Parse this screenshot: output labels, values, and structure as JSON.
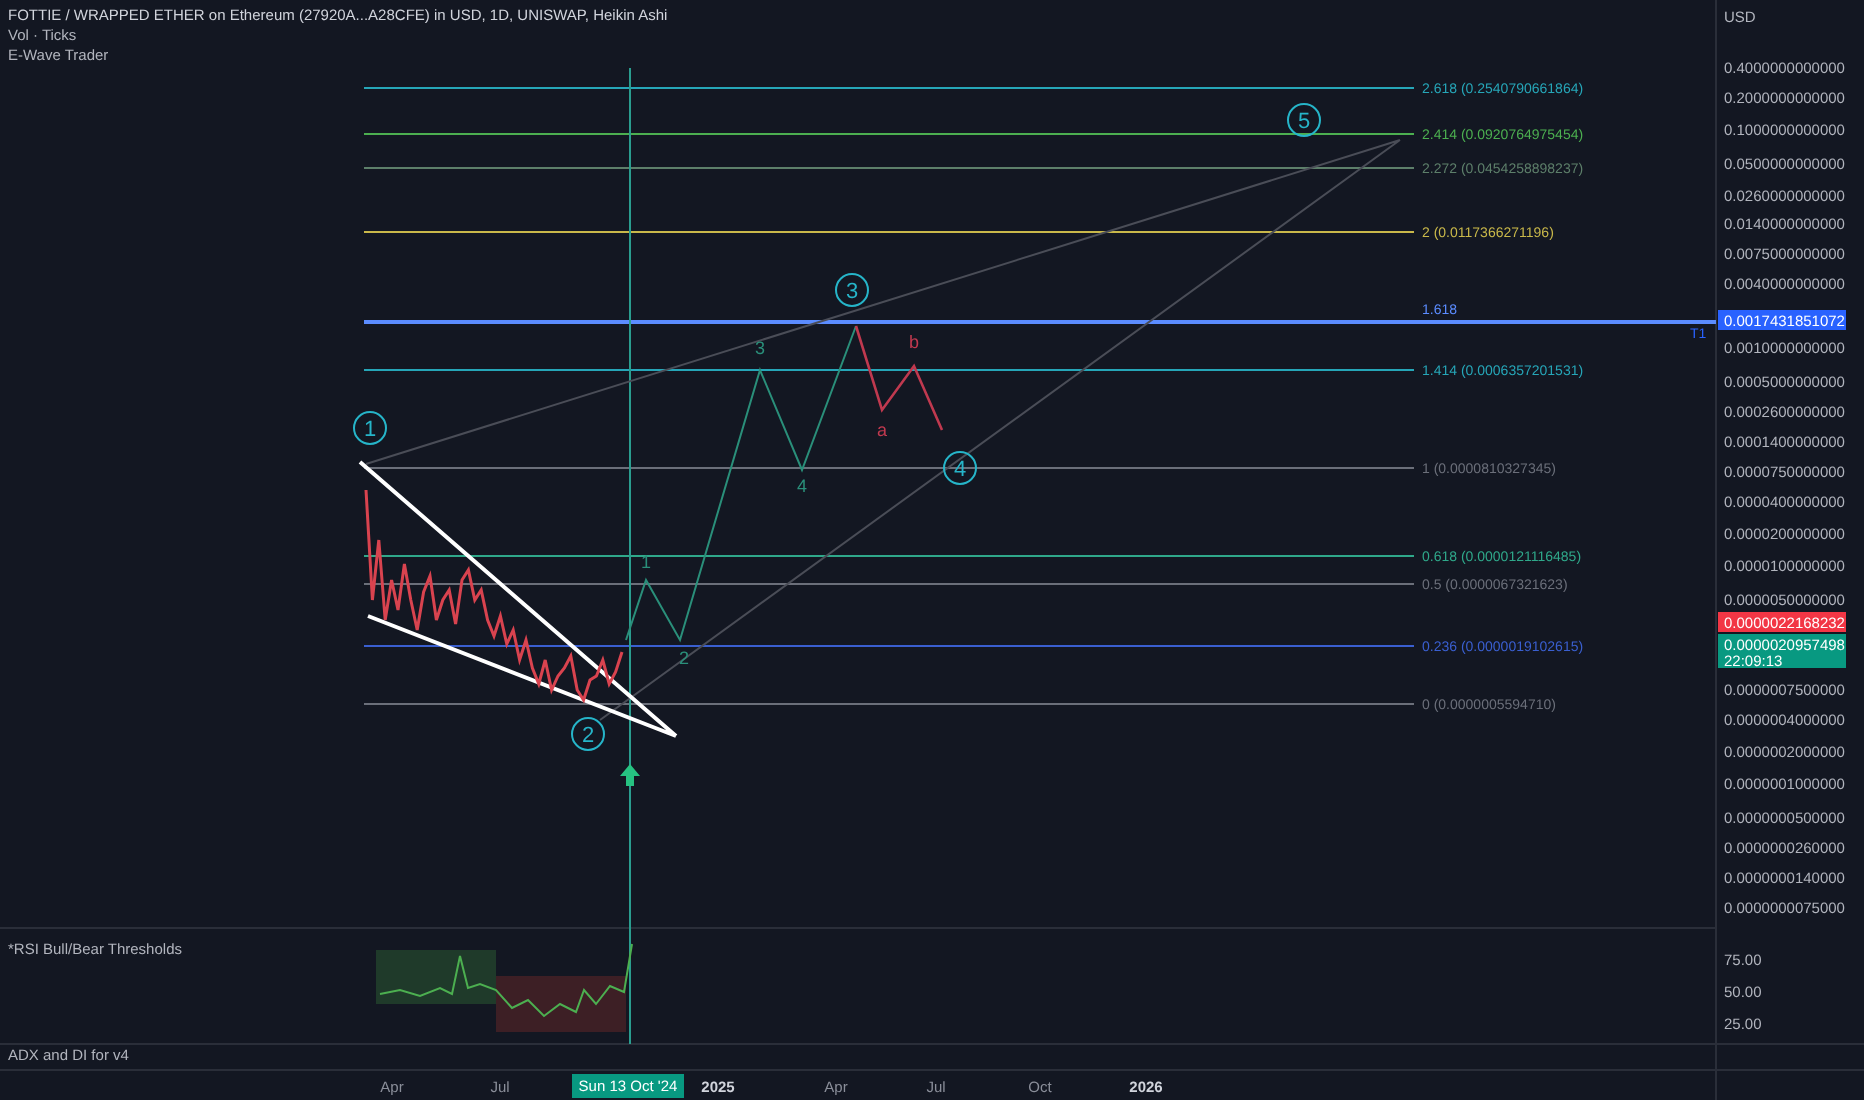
{
  "header": {
    "title": "FOTTIE / WRAPPED ETHER on Ethereum (27920A...A28CFE) in USD, 1D, UNISWAP, Heikin Ashi",
    "indicators": [
      "Vol · Ticks",
      "E-Wave Trader"
    ]
  },
  "fib_levels": [
    {
      "label": "2.618 (0.2540790661864)",
      "color": "#26a6b8"
    },
    {
      "label": "2.414 (0.0920764975454)",
      "color": "#4caf50"
    },
    {
      "label": "2.272 (0.0454258898237)",
      "color": "#5d7f6a"
    },
    {
      "label": "2 (0.0117366271196)",
      "color": "#c9b84a"
    },
    {
      "label": "1.618",
      "color": "#5b8cff"
    },
    {
      "label": "1.414 (0.0006357201531)",
      "color": "#26a6b8"
    },
    {
      "label": "1 (0.0000810327345)",
      "color": "#6b6f7a"
    },
    {
      "label": "0.618 (0.0000121116485)",
      "color": "#2fa88a"
    },
    {
      "label": "0.5 (0.0000067321623)",
      "color": "#6b6f7a"
    },
    {
      "label": "0.236 (0.0000019102615)",
      "color": "#3a5fd0"
    },
    {
      "label": "0 (0.0000005594710)",
      "color": "#6b6f7a"
    }
  ],
  "wave_labels": [
    {
      "text": "1",
      "kind": "major",
      "color": "#26b5c9"
    },
    {
      "text": "2",
      "kind": "major",
      "color": "#26b5c9"
    },
    {
      "text": "3",
      "kind": "major",
      "color": "#26b5c9"
    },
    {
      "text": "4",
      "kind": "major",
      "color": "#26b5c9"
    },
    {
      "text": "5",
      "kind": "major",
      "color": "#26b5c9"
    },
    {
      "text": "1",
      "kind": "minor",
      "color": "#2a8f7a"
    },
    {
      "text": "2",
      "kind": "minor",
      "color": "#2a8f7a"
    },
    {
      "text": "3",
      "kind": "minor",
      "color": "#2a8f7a"
    },
    {
      "text": "4",
      "kind": "minor",
      "color": "#2a8f7a"
    },
    {
      "text": "a",
      "kind": "minor",
      "color": "#c0394f"
    },
    {
      "text": "b",
      "kind": "minor",
      "color": "#c0394f"
    }
  ],
  "target_label": "T1",
  "price_axis": {
    "currency": "USD",
    "ticks": [
      "0.4000000000000",
      "0.2000000000000",
      "0.1000000000000",
      "0.0500000000000",
      "0.0260000000000",
      "0.0140000000000",
      "0.0075000000000",
      "0.0040000000000",
      "0.0010000000000",
      "0.0005000000000",
      "0.0002600000000",
      "0.0001400000000",
      "0.0000750000000",
      "0.0000400000000",
      "0.0000200000000",
      "0.0000100000000",
      "0.0000050000000",
      "0.0000007500000",
      "0.0000004000000",
      "0.0000002000000",
      "0.0000001000000",
      "0.0000000500000",
      "0.0000000260000",
      "0.0000000140000",
      "0.0000000075000"
    ],
    "badges": [
      {
        "kind": "target",
        "text": "0.0017431851072"
      },
      {
        "kind": "high",
        "text": "0.0000022168232"
      },
      {
        "kind": "last",
        "text": "0.0000020957498",
        "countdown": "22:09:13"
      }
    ]
  },
  "rsi_pane": {
    "title": "*RSI Bull/Bear Thresholds",
    "ticks": [
      "75.00",
      "50.00",
      "25.00"
    ]
  },
  "adx_pane": {
    "title": "ADX and DI for v4"
  },
  "time_axis": [
    {
      "text": "Apr",
      "kind": "tick"
    },
    {
      "text": "Jul",
      "kind": "tick"
    },
    {
      "text": "Sun 13 Oct '24",
      "kind": "crosshair"
    },
    {
      "text": "2025",
      "kind": "year"
    },
    {
      "text": "Apr",
      "kind": "tick"
    },
    {
      "text": "Jul",
      "kind": "tick"
    },
    {
      "text": "Oct",
      "kind": "tick"
    },
    {
      "text": "2026",
      "kind": "year"
    }
  ]
}
